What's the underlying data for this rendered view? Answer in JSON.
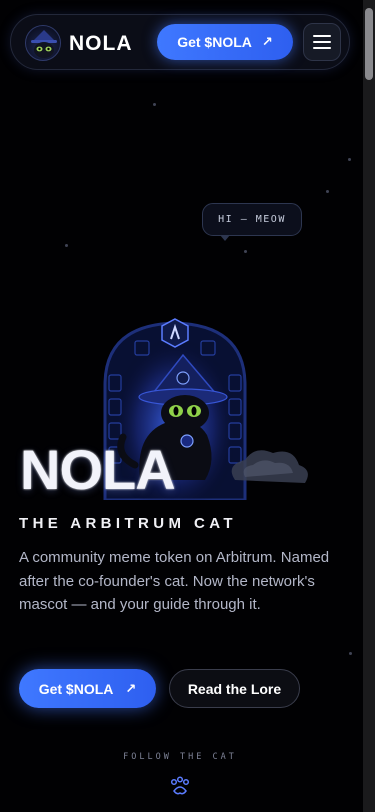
{
  "header": {
    "brand": "NOLA",
    "cta_label": "Get $NOLA",
    "cta_icon": "arrow-up-right-icon",
    "menu_icon": "hamburger-menu-icon"
  },
  "hero": {
    "speech_bubble": "HI — MEOW",
    "title": "NOLA",
    "tagline": "THE ARBITRUM CAT",
    "description": "A community meme token on Arbitrum. Named after the co-founder's cat. Now the network's mascot — and your guide through it.",
    "primary_button": "Get $NOLA",
    "secondary_button": "Read the Lore"
  },
  "follow": {
    "label": "FOLLOW THE CAT",
    "icon": "paw-icon"
  },
  "colors": {
    "accent": "#3f78ff",
    "background": "#010103",
    "text_muted": "#b3b7c8"
  }
}
